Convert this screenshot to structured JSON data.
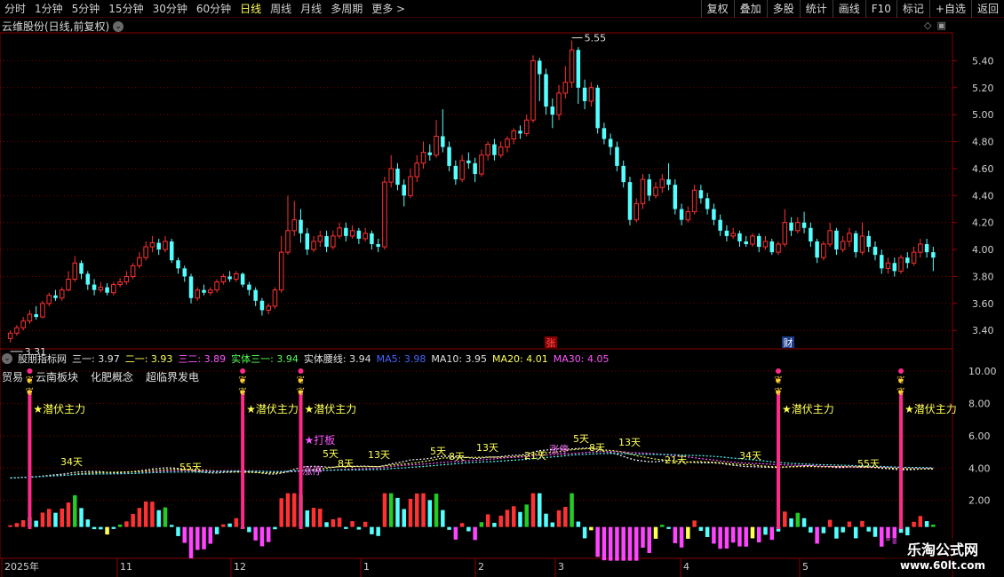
{
  "toolbar": {
    "periods": [
      "分时",
      "1分钟",
      "5分钟",
      "15分钟",
      "30分钟",
      "60分钟",
      "日线",
      "周线",
      "月线",
      "多周期",
      "更多 >"
    ],
    "active_period": "日线",
    "right_buttons": [
      "复权",
      "叠加",
      "多股",
      "统计",
      "画线",
      "F10",
      "标记",
      "+自选",
      "返回"
    ]
  },
  "stock": {
    "title": "云维股份(日线,前复权)",
    "high_label": "5.55",
    "low_label": "3.31",
    "event_markers": [
      "张",
      "财"
    ]
  },
  "price_axis": [
    "5.40",
    "5.20",
    "5.00",
    "4.80",
    "4.60",
    "4.40",
    "4.20",
    "4.00",
    "3.80",
    "3.60",
    "3.40"
  ],
  "indicator": {
    "name": "股朋指标网",
    "items": [
      {
        "label": "三一:",
        "value": "3.97",
        "color": "#e0e0e0"
      },
      {
        "label": "二一:",
        "value": "3.93",
        "color": "#ffff55"
      },
      {
        "label": "三二:",
        "value": "3.89",
        "color": "#ff55ff"
      },
      {
        "label": "实体三一:",
        "value": "3.94",
        "color": "#55ff55"
      },
      {
        "label": "实体腰线:",
        "value": "3.94",
        "color": "#e0e0e0"
      },
      {
        "label": "MA5:",
        "value": "3.98",
        "color": "#4466ff"
      },
      {
        "label": "MA10:",
        "value": "3.95",
        "color": "#e0e0e0"
      },
      {
        "label": "MA20:",
        "value": "4.01",
        "color": "#ffff55"
      },
      {
        "label": "MA30:",
        "value": "4.05",
        "color": "#ff55ff"
      }
    ],
    "tags": [
      "贸易",
      "云南板块",
      "化肥概念",
      "超临界发电"
    ]
  },
  "indicator_axis": [
    "10.00",
    "8.00",
    "6.00",
    "4.00",
    "2.00"
  ],
  "signals": {
    "latent": "★潜伏主力",
    "board": "★打板",
    "limit_up": "涨停",
    "day_labels": [
      "34天",
      "55天",
      "5天",
      "8天",
      "13天",
      "5天",
      "8天",
      "13天",
      "21天",
      "5天",
      "8天",
      "13天",
      "21天",
      "34天",
      "55天"
    ]
  },
  "time_axis": [
    "2025年",
    "11",
    "12",
    "1",
    "2",
    "3",
    "4",
    "5"
  ],
  "watermark": {
    "name": "乐淘公式网",
    "url": "www.60lt.com"
  },
  "colors": {
    "up": "#ff3232",
    "down": "#54ffff",
    "grid": "#7a0000",
    "axis_text": "#d0d0d0",
    "signal_bar": "#ff2a8a",
    "yellow": "#ffff55",
    "magenta": "#ff55ff"
  },
  "chart_data": {
    "type": "candlestick",
    "price_range": [
      3.27,
      5.6
    ],
    "candles": [
      {
        "o": 3.34,
        "c": 3.38,
        "h": 3.4,
        "l": 3.31
      },
      {
        "o": 3.38,
        "c": 3.42,
        "h": 3.44,
        "l": 3.36
      },
      {
        "o": 3.42,
        "c": 3.47,
        "h": 3.5,
        "l": 3.4
      },
      {
        "o": 3.47,
        "c": 3.52,
        "h": 3.55,
        "l": 3.45
      },
      {
        "o": 3.52,
        "c": 3.5,
        "h": 3.58,
        "l": 3.48
      },
      {
        "o": 3.5,
        "c": 3.6,
        "h": 3.62,
        "l": 3.49
      },
      {
        "o": 3.6,
        "c": 3.66,
        "h": 3.68,
        "l": 3.58
      },
      {
        "o": 3.66,
        "c": 3.64,
        "h": 3.7,
        "l": 3.62
      },
      {
        "o": 3.64,
        "c": 3.7,
        "h": 3.72,
        "l": 3.62
      },
      {
        "o": 3.7,
        "c": 3.78,
        "h": 3.84,
        "l": 3.69
      },
      {
        "o": 3.78,
        "c": 3.9,
        "h": 3.95,
        "l": 3.76
      },
      {
        "o": 3.9,
        "c": 3.82,
        "h": 3.92,
        "l": 3.78
      },
      {
        "o": 3.82,
        "c": 3.74,
        "h": 3.84,
        "l": 3.7
      },
      {
        "o": 3.74,
        "c": 3.7,
        "h": 3.78,
        "l": 3.66
      },
      {
        "o": 3.7,
        "c": 3.72,
        "h": 3.76,
        "l": 3.68
      },
      {
        "o": 3.72,
        "c": 3.68,
        "h": 3.75,
        "l": 3.66
      },
      {
        "o": 3.68,
        "c": 3.74,
        "h": 3.76,
        "l": 3.66
      },
      {
        "o": 3.74,
        "c": 3.76,
        "h": 3.79,
        "l": 3.72
      },
      {
        "o": 3.76,
        "c": 3.8,
        "h": 3.84,
        "l": 3.74
      },
      {
        "o": 3.8,
        "c": 3.88,
        "h": 3.9,
        "l": 3.78
      },
      {
        "o": 3.88,
        "c": 3.94,
        "h": 3.98,
        "l": 3.86
      },
      {
        "o": 3.94,
        "c": 4.02,
        "h": 4.06,
        "l": 3.92
      },
      {
        "o": 4.02,
        "c": 4.05,
        "h": 4.1,
        "l": 3.98
      },
      {
        "o": 4.05,
        "c": 4.0,
        "h": 4.08,
        "l": 3.96
      },
      {
        "o": 4.0,
        "c": 4.06,
        "h": 4.1,
        "l": 3.98
      },
      {
        "o": 4.06,
        "c": 3.92,
        "h": 4.08,
        "l": 3.9
      },
      {
        "o": 3.92,
        "c": 3.86,
        "h": 3.94,
        "l": 3.82
      },
      {
        "o": 3.86,
        "c": 3.8,
        "h": 3.88,
        "l": 3.76
      },
      {
        "o": 3.8,
        "c": 3.64,
        "h": 3.82,
        "l": 3.6
      },
      {
        "o": 3.64,
        "c": 3.7,
        "h": 3.72,
        "l": 3.62
      },
      {
        "o": 3.7,
        "c": 3.68,
        "h": 3.74,
        "l": 3.66
      },
      {
        "o": 3.68,
        "c": 3.7,
        "h": 3.72,
        "l": 3.66
      },
      {
        "o": 3.7,
        "c": 3.76,
        "h": 3.78,
        "l": 3.68
      },
      {
        "o": 3.76,
        "c": 3.8,
        "h": 3.82,
        "l": 3.74
      },
      {
        "o": 3.8,
        "c": 3.78,
        "h": 3.84,
        "l": 3.76
      },
      {
        "o": 3.78,
        "c": 3.82,
        "h": 3.84,
        "l": 3.76
      },
      {
        "o": 3.82,
        "c": 3.74,
        "h": 3.83,
        "l": 3.72
      },
      {
        "o": 3.74,
        "c": 3.7,
        "h": 3.76,
        "l": 3.66
      },
      {
        "o": 3.7,
        "c": 3.62,
        "h": 3.72,
        "l": 3.58
      },
      {
        "o": 3.62,
        "c": 3.55,
        "h": 3.64,
        "l": 3.51
      },
      {
        "o": 3.55,
        "c": 3.58,
        "h": 3.6,
        "l": 3.52
      },
      {
        "o": 3.58,
        "c": 3.7,
        "h": 3.72,
        "l": 3.56
      },
      {
        "o": 3.7,
        "c": 3.98,
        "h": 4.1,
        "l": 3.68
      },
      {
        "o": 3.98,
        "c": 4.14,
        "h": 4.4,
        "l": 3.96
      },
      {
        "o": 4.14,
        "c": 4.22,
        "h": 4.36,
        "l": 4.1
      },
      {
        "o": 4.22,
        "c": 4.12,
        "h": 4.3,
        "l": 4.05
      },
      {
        "o": 4.12,
        "c": 4.0,
        "h": 4.16,
        "l": 3.96
      },
      {
        "o": 4.0,
        "c": 4.06,
        "h": 4.1,
        "l": 3.98
      },
      {
        "o": 4.06,
        "c": 4.1,
        "h": 4.14,
        "l": 4.02
      },
      {
        "o": 4.1,
        "c": 4.02,
        "h": 4.14,
        "l": 3.98
      },
      {
        "o": 4.02,
        "c": 4.1,
        "h": 4.14,
        "l": 4.0
      },
      {
        "o": 4.1,
        "c": 4.16,
        "h": 4.2,
        "l": 4.08
      },
      {
        "o": 4.16,
        "c": 4.1,
        "h": 4.2,
        "l": 4.06
      },
      {
        "o": 4.1,
        "c": 4.14,
        "h": 4.18,
        "l": 4.08
      },
      {
        "o": 4.14,
        "c": 4.08,
        "h": 4.16,
        "l": 4.04
      },
      {
        "o": 4.08,
        "c": 4.12,
        "h": 4.16,
        "l": 4.06
      },
      {
        "o": 4.12,
        "c": 4.04,
        "h": 4.14,
        "l": 4.0
      },
      {
        "o": 4.04,
        "c": 4.02,
        "h": 4.08,
        "l": 3.98
      },
      {
        "o": 4.02,
        "c": 4.5,
        "h": 4.54,
        "l": 4.0
      },
      {
        "o": 4.5,
        "c": 4.6,
        "h": 4.7,
        "l": 4.46
      },
      {
        "o": 4.6,
        "c": 4.48,
        "h": 4.64,
        "l": 4.44
      },
      {
        "o": 4.48,
        "c": 4.4,
        "h": 4.52,
        "l": 4.32
      },
      {
        "o": 4.4,
        "c": 4.54,
        "h": 4.6,
        "l": 4.38
      },
      {
        "o": 4.54,
        "c": 4.64,
        "h": 4.7,
        "l": 4.5
      },
      {
        "o": 4.64,
        "c": 4.72,
        "h": 4.8,
        "l": 4.6
      },
      {
        "o": 4.72,
        "c": 4.7,
        "h": 4.78,
        "l": 4.66
      },
      {
        "o": 4.7,
        "c": 4.84,
        "h": 4.96,
        "l": 4.68
      },
      {
        "o": 4.84,
        "c": 4.76,
        "h": 5.04,
        "l": 4.72
      },
      {
        "o": 4.76,
        "c": 4.62,
        "h": 4.8,
        "l": 4.58
      },
      {
        "o": 4.62,
        "c": 4.52,
        "h": 4.66,
        "l": 4.48
      },
      {
        "o": 4.52,
        "c": 4.66,
        "h": 4.7,
        "l": 4.5
      },
      {
        "o": 4.66,
        "c": 4.64,
        "h": 4.72,
        "l": 4.6
      },
      {
        "o": 4.64,
        "c": 4.56,
        "h": 4.68,
        "l": 4.5
      },
      {
        "o": 4.56,
        "c": 4.7,
        "h": 4.74,
        "l": 4.54
      },
      {
        "o": 4.7,
        "c": 4.78,
        "h": 4.8,
        "l": 4.66
      },
      {
        "o": 4.78,
        "c": 4.7,
        "h": 4.82,
        "l": 4.66
      },
      {
        "o": 4.7,
        "c": 4.76,
        "h": 4.8,
        "l": 4.68
      },
      {
        "o": 4.76,
        "c": 4.82,
        "h": 4.84,
        "l": 4.72
      },
      {
        "o": 4.82,
        "c": 4.88,
        "h": 4.9,
        "l": 4.78
      },
      {
        "o": 4.88,
        "c": 4.86,
        "h": 4.92,
        "l": 4.82
      },
      {
        "o": 4.86,
        "c": 4.96,
        "h": 5.0,
        "l": 4.84
      },
      {
        "o": 4.96,
        "c": 5.4,
        "h": 5.44,
        "l": 4.94
      },
      {
        "o": 5.4,
        "c": 5.3,
        "h": 5.42,
        "l": 5.1
      },
      {
        "o": 5.3,
        "c": 5.06,
        "h": 5.34,
        "l": 5.0
      },
      {
        "o": 5.06,
        "c": 5.0,
        "h": 5.12,
        "l": 4.9
      },
      {
        "o": 5.0,
        "c": 5.16,
        "h": 5.22,
        "l": 4.96
      },
      {
        "o": 5.16,
        "c": 5.24,
        "h": 5.36,
        "l": 5.12
      },
      {
        "o": 5.24,
        "c": 5.48,
        "h": 5.55,
        "l": 5.2
      },
      {
        "o": 5.48,
        "c": 5.2,
        "h": 5.5,
        "l": 5.08
      },
      {
        "o": 5.2,
        "c": 5.1,
        "h": 5.26,
        "l": 5.04
      },
      {
        "o": 5.1,
        "c": 5.2,
        "h": 5.24,
        "l": 5.06
      },
      {
        "o": 5.2,
        "c": 4.9,
        "h": 5.22,
        "l": 4.86
      },
      {
        "o": 4.9,
        "c": 4.82,
        "h": 4.94,
        "l": 4.78
      },
      {
        "o": 4.82,
        "c": 4.76,
        "h": 4.86,
        "l": 4.7
      },
      {
        "o": 4.76,
        "c": 4.62,
        "h": 4.8,
        "l": 4.58
      },
      {
        "o": 4.62,
        "c": 4.5,
        "h": 4.66,
        "l": 4.46
      },
      {
        "o": 4.5,
        "c": 4.22,
        "h": 4.54,
        "l": 4.18
      },
      {
        "o": 4.22,
        "c": 4.34,
        "h": 4.38,
        "l": 4.2
      },
      {
        "o": 4.34,
        "c": 4.52,
        "h": 4.56,
        "l": 4.3
      },
      {
        "o": 4.52,
        "c": 4.4,
        "h": 4.56,
        "l": 4.36
      },
      {
        "o": 4.4,
        "c": 4.46,
        "h": 4.5,
        "l": 4.38
      },
      {
        "o": 4.46,
        "c": 4.52,
        "h": 4.56,
        "l": 4.42
      },
      {
        "o": 4.52,
        "c": 4.48,
        "h": 4.64,
        "l": 4.44
      },
      {
        "o": 4.48,
        "c": 4.3,
        "h": 4.52,
        "l": 4.26
      },
      {
        "o": 4.3,
        "c": 4.22,
        "h": 4.34,
        "l": 4.18
      },
      {
        "o": 4.22,
        "c": 4.28,
        "h": 4.32,
        "l": 4.2
      },
      {
        "o": 4.28,
        "c": 4.44,
        "h": 4.48,
        "l": 4.26
      },
      {
        "o": 4.44,
        "c": 4.38,
        "h": 4.48,
        "l": 4.34
      },
      {
        "o": 4.38,
        "c": 4.3,
        "h": 4.42,
        "l": 4.26
      },
      {
        "o": 4.3,
        "c": 4.22,
        "h": 4.34,
        "l": 4.18
      },
      {
        "o": 4.22,
        "c": 4.14,
        "h": 4.26,
        "l": 4.1
      },
      {
        "o": 4.14,
        "c": 4.1,
        "h": 4.18,
        "l": 4.06
      },
      {
        "o": 4.1,
        "c": 4.12,
        "h": 4.16,
        "l": 4.08
      },
      {
        "o": 4.12,
        "c": 4.06,
        "h": 4.14,
        "l": 4.02
      },
      {
        "o": 4.06,
        "c": 4.04,
        "h": 4.1,
        "l": 4.02
      },
      {
        "o": 4.04,
        "c": 4.1,
        "h": 4.12,
        "l": 4.02
      },
      {
        "o": 4.1,
        "c": 4.02,
        "h": 4.12,
        "l": 3.98
      },
      {
        "o": 4.02,
        "c": 4.06,
        "h": 4.1,
        "l": 4.0
      },
      {
        "o": 4.06,
        "c": 3.98,
        "h": 4.08,
        "l": 3.96
      },
      {
        "o": 3.98,
        "c": 4.04,
        "h": 4.06,
        "l": 3.96
      },
      {
        "o": 4.04,
        "c": 4.2,
        "h": 4.3,
        "l": 4.02
      },
      {
        "o": 4.2,
        "c": 4.14,
        "h": 4.24,
        "l": 4.1
      },
      {
        "o": 4.14,
        "c": 4.2,
        "h": 4.24,
        "l": 4.12
      },
      {
        "o": 4.2,
        "c": 4.16,
        "h": 4.28,
        "l": 4.12
      },
      {
        "o": 4.16,
        "c": 4.06,
        "h": 4.2,
        "l": 4.02
      },
      {
        "o": 4.06,
        "c": 3.94,
        "h": 4.08,
        "l": 3.9
      },
      {
        "o": 3.94,
        "c": 4.04,
        "h": 4.06,
        "l": 3.92
      },
      {
        "o": 4.04,
        "c": 4.14,
        "h": 4.2,
        "l": 4.02
      },
      {
        "o": 4.14,
        "c": 4.0,
        "h": 4.16,
        "l": 3.96
      },
      {
        "o": 4.0,
        "c": 4.06,
        "h": 4.1,
        "l": 3.98
      },
      {
        "o": 4.06,
        "c": 4.12,
        "h": 4.16,
        "l": 4.02
      },
      {
        "o": 4.12,
        "c": 3.98,
        "h": 4.14,
        "l": 3.94
      },
      {
        "o": 3.98,
        "c": 4.1,
        "h": 4.2,
        "l": 3.96
      },
      {
        "o": 4.1,
        "c": 4.02,
        "h": 4.14,
        "l": 3.98
      },
      {
        "o": 4.02,
        "c": 3.96,
        "h": 4.06,
        "l": 3.92
      },
      {
        "o": 3.96,
        "c": 3.86,
        "h": 4.0,
        "l": 3.82
      },
      {
        "o": 3.86,
        "c": 3.9,
        "h": 3.94,
        "l": 3.82
      },
      {
        "o": 3.9,
        "c": 3.84,
        "h": 3.94,
        "l": 3.8
      },
      {
        "o": 3.84,
        "c": 3.94,
        "h": 3.96,
        "l": 3.82
      },
      {
        "o": 3.94,
        "c": 3.9,
        "h": 3.98,
        "l": 3.86
      },
      {
        "o": 3.9,
        "c": 3.98,
        "h": 4.02,
        "l": 3.88
      },
      {
        "o": 3.98,
        "c": 4.04,
        "h": 4.08,
        "l": 3.94
      },
      {
        "o": 4.04,
        "c": 3.98,
        "h": 4.08,
        "l": 3.94
      },
      {
        "o": 3.98,
        "c": 3.94,
        "h": 4.02,
        "l": 3.84
      }
    ],
    "indicator_range": [
      0,
      11
    ]
  }
}
